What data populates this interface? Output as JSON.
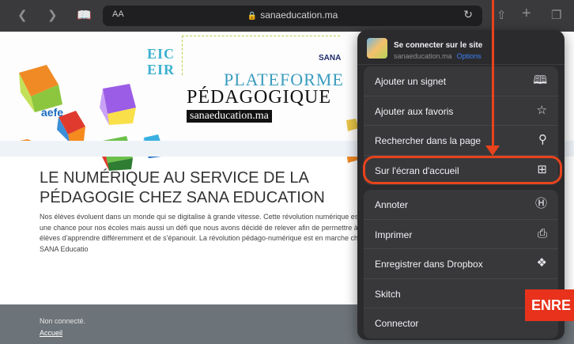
{
  "browser": {
    "reader_label": "AA",
    "url": "sanaeducation.ma",
    "icons": [
      "back-icon",
      "forward-icon",
      "bookmarks-icon",
      "lock-icon",
      "reload-icon",
      "share-icon",
      "new-tab-icon",
      "tabs-icon"
    ]
  },
  "banner": {
    "eic_line1": "EIC",
    "eic_line2": "EIR",
    "title_line1": "PLATEFORME",
    "title_line2": "PÉDAGOGIQUE",
    "domain": "sanaeducation.ma",
    "aefe_logo": "aefe",
    "sana_logo": "SANA"
  },
  "article": {
    "headline": "LE NUMÉRIQUE AU SERVICE DE LA PÉDAGOGIE CHEZ SANA EDUCATION",
    "body": "Nos élèves évoluent dans un monde qui se digitalise à grande vitesse. Cette révolution numérique est une chance pour nos écoles mais aussi un défi que nous avons décidé de relever afin de permettre à nos élèves d'apprendre différemment et de s'épanouir. La révolution pédago-numérique est en marche chez SANA Educatio"
  },
  "footer": {
    "status": "Non connecté.",
    "home_link": "Accueil"
  },
  "share_sheet": {
    "header_title": "Se connecter sur le site",
    "header_domain": "sanaeducation.ma",
    "header_options": "Options",
    "group1": [
      {
        "label": "Ajouter un signet",
        "icon": "book-icon"
      },
      {
        "label": "Ajouter aux favoris",
        "icon": "star-icon"
      },
      {
        "label": "Rechercher dans la page",
        "icon": "search-icon"
      },
      {
        "label": "Sur l'écran d'accueil",
        "icon": "add-square-icon"
      }
    ],
    "group2": [
      {
        "label": "Annoter",
        "icon": "markup-icon"
      },
      {
        "label": "Imprimer",
        "icon": "printer-icon"
      },
      {
        "label": "Enregistrer dans Dropbox",
        "icon": "dropbox-icon"
      },
      {
        "label": "Skitch",
        "icon": ""
      },
      {
        "label": "Connector",
        "icon": ""
      }
    ]
  },
  "overlay": {
    "banner_text": "ENRE",
    "accent_color": "#e8431b"
  }
}
